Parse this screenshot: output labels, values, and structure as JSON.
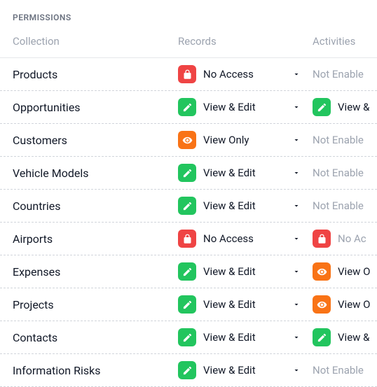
{
  "section_title": "PERMISSIONS",
  "headers": {
    "collection": "Collection",
    "records": "Records",
    "activities": "Activities"
  },
  "permission_types": {
    "no_access": {
      "label": "No Access",
      "icon": "lock",
      "color": "red"
    },
    "view_edit": {
      "label": "View & Edit",
      "icon": "pencil",
      "color": "green"
    },
    "view_only": {
      "label": "View Only",
      "icon": "eye",
      "color": "orange"
    },
    "not_enabled": {
      "label": "Not Enabled",
      "disabled": true
    }
  },
  "rows": [
    {
      "collection": "Products",
      "records": "no_access",
      "activities": "not_enabled",
      "activities_label": "Not Enable"
    },
    {
      "collection": "Opportunities",
      "records": "view_edit",
      "activities": "view_edit",
      "activities_label": "View &"
    },
    {
      "collection": "Customers",
      "records": "view_only",
      "activities": "not_enabled",
      "activities_label": "Not Enable"
    },
    {
      "collection": "Vehicle Models",
      "records": "view_edit",
      "activities": "not_enabled",
      "activities_label": "Not Enable"
    },
    {
      "collection": "Countries",
      "records": "view_edit",
      "activities": "not_enabled",
      "activities_label": "Not Enable"
    },
    {
      "collection": "Airports",
      "records": "no_access",
      "activities": "no_access",
      "activities_label": "No Ac",
      "activities_disabled": true
    },
    {
      "collection": "Expenses",
      "records": "view_edit",
      "activities": "view_only",
      "activities_label": "View O",
      "activities_icon_color": "orange"
    },
    {
      "collection": "Projects",
      "records": "view_edit",
      "activities": "view_only",
      "activities_label": "View O",
      "activities_icon_color": "orange"
    },
    {
      "collection": "Contacts",
      "records": "view_edit",
      "activities": "view_edit",
      "activities_label": "View &"
    },
    {
      "collection": "Information Risks",
      "records": "view_edit",
      "activities": "not_enabled",
      "activities_label": "Not Enable"
    }
  ]
}
